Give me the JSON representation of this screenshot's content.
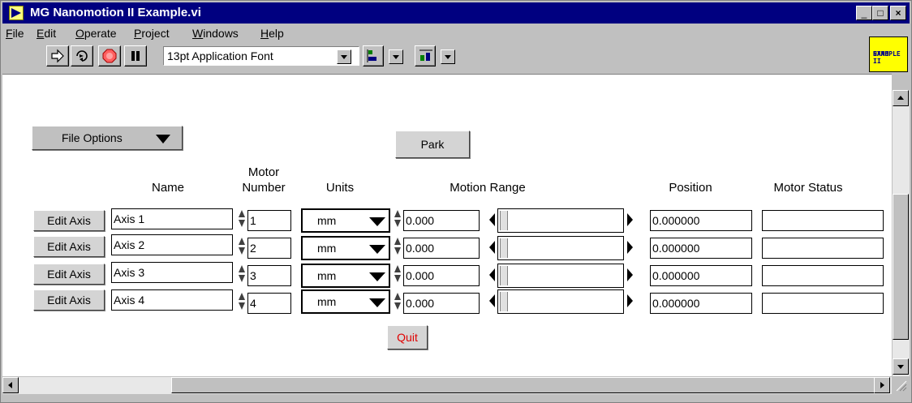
{
  "window": {
    "title": "MG Nanomotion II Example.vi",
    "min": "_",
    "max": "□",
    "close": "×"
  },
  "menu": [
    {
      "prefix": "",
      "ul": "F",
      "rest": "ile"
    },
    {
      "prefix": "",
      "ul": "E",
      "rest": "dit"
    },
    {
      "prefix": "",
      "ul": "O",
      "rest": "perate"
    },
    {
      "prefix": "",
      "ul": "P",
      "rest": "roject"
    },
    {
      "prefix": "",
      "ul": "W",
      "rest": "indows"
    },
    {
      "prefix": "",
      "ul": "H",
      "rest": "elp"
    }
  ],
  "toolbar": {
    "font": "13pt Application Font",
    "icons": [
      "run-arrow-icon",
      "run-continuous-icon",
      "abort-icon",
      "pause-icon",
      "align-objects-icon",
      "distribute-objects-icon"
    ]
  },
  "logo": {
    "line1": "NANO II",
    "line2": "EXAMPLE",
    "color": "#ffff00"
  },
  "panel": {
    "file_options": "File Options",
    "park": "Park",
    "quit": "Quit",
    "headers": {
      "name": "Name",
      "motor_number_1": "Motor",
      "motor_number_2": "Number",
      "units": "Units",
      "motion_range": "Motion Range",
      "position": "Position",
      "motor_status": "Motor Status"
    },
    "rows": [
      {
        "edit": "Edit Axis",
        "name": "Axis 1",
        "motor": "1",
        "units": "mm",
        "range": "0.000",
        "position": "0.000000",
        "status": ""
      },
      {
        "edit": "Edit Axis",
        "name": "Axis 2",
        "motor": "2",
        "units": "mm",
        "range": "0.000",
        "position": "0.000000",
        "status": ""
      },
      {
        "edit": "Edit Axis",
        "name": "Axis 3",
        "motor": "3",
        "units": "mm",
        "range": "0.000",
        "position": "0.000000",
        "status": ""
      },
      {
        "edit": "Edit Axis",
        "name": "Axis 4",
        "motor": "4",
        "units": "mm",
        "range": "0.000",
        "position": "0.000000",
        "status": ""
      }
    ]
  },
  "colors": {
    "titlebar": "#000080",
    "quit_text": "#e00000"
  }
}
